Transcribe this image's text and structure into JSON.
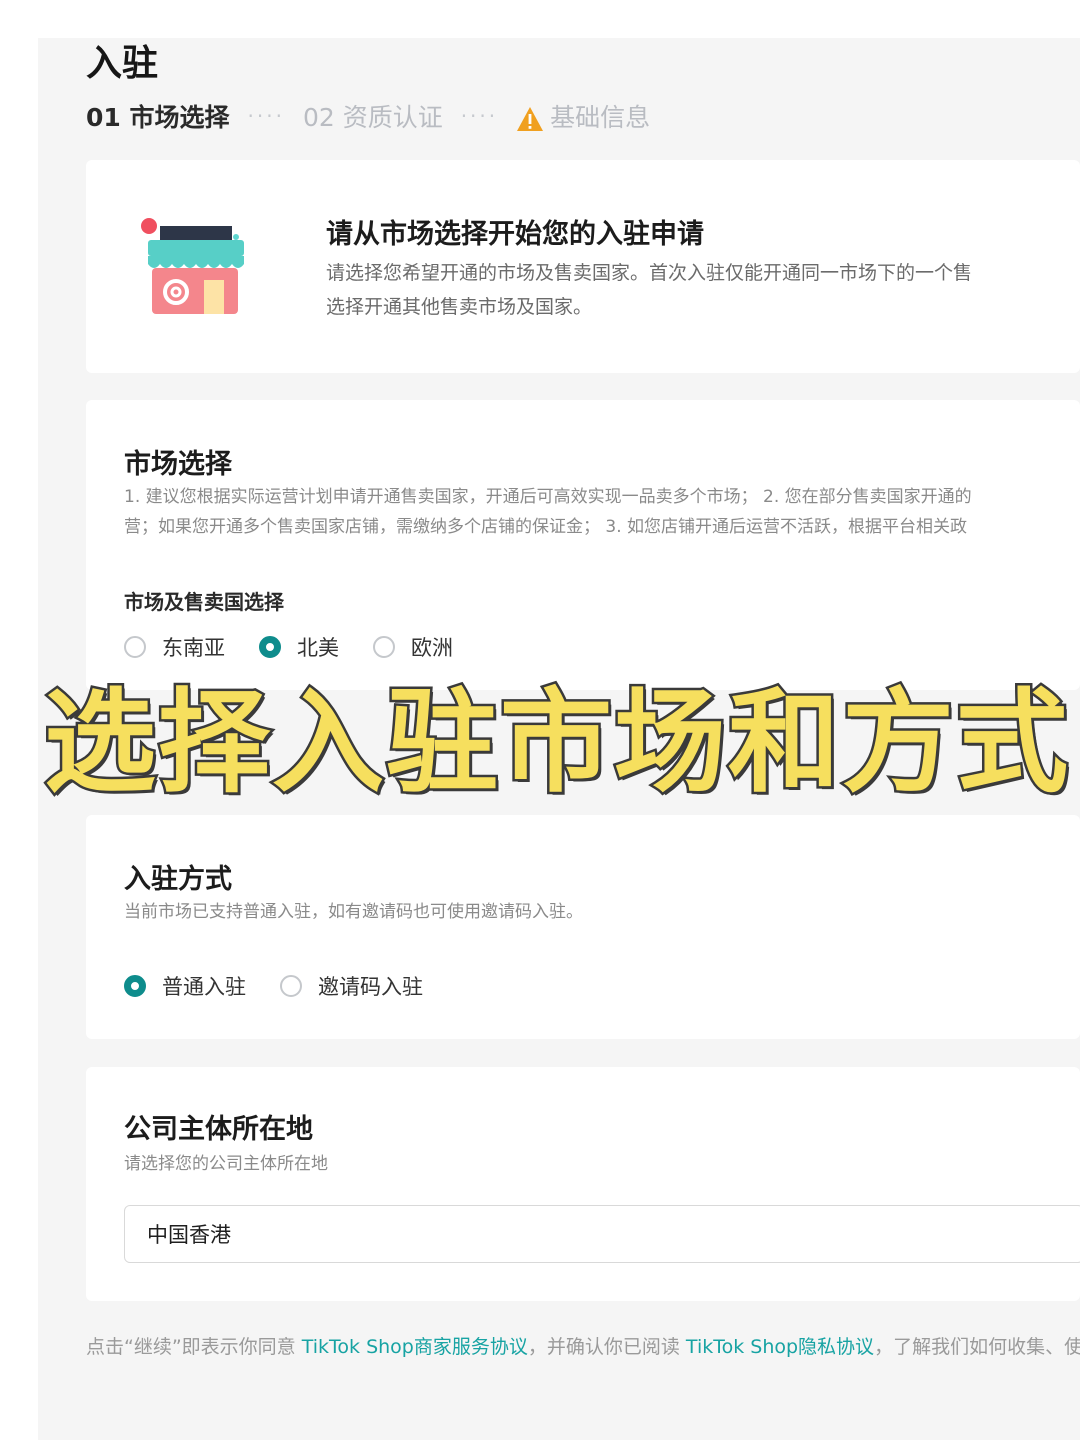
{
  "page": {
    "title": "入驻"
  },
  "steps": [
    {
      "label": "01 市场选择",
      "state": "active"
    },
    {
      "label": "02 资质认证",
      "state": "inactive"
    },
    {
      "label": "基础信息",
      "state": "warning",
      "icon": "warning-icon"
    }
  ],
  "step_separator": "····",
  "intro": {
    "icon": "shop-icon",
    "title": "请从市场选择开始您的入驻申请",
    "desc_line1": "请选择您希望开通的市场及售卖国家。首次入驻仅能开通同一市场下的一个售",
    "desc_line2": "选择开通其他售卖市场及国家。"
  },
  "market": {
    "title": "市场选择",
    "desc_line1": "1. 建议您根据实际运营计划申请开通售卖国家，开通后可高效实现一品卖多个市场； 2. 您在部分售卖国家开通的",
    "desc_line2": "营；如果您开通多个售卖国家店铺，需缴纳多个店铺的保证金； 3. 如您店铺开通后运营不活跃，根据平台相关政",
    "sub_label": "市场及售卖国选择",
    "options": [
      {
        "label": "东南亚",
        "checked": false
      },
      {
        "label": "北美",
        "checked": true
      },
      {
        "label": "欧洲",
        "checked": false
      }
    ]
  },
  "method": {
    "title": "入驻方式",
    "desc": "当前市场已支持普通入驻，如有邀请码也可使用邀请码入驻。",
    "options": [
      {
        "label": "普通入驻",
        "checked": true
      },
      {
        "label": "邀请码入驻",
        "checked": false
      }
    ]
  },
  "location": {
    "title": "公司主体所在地",
    "desc": "请选择您的公司主体所在地",
    "value": "中国香港"
  },
  "footer": {
    "prefix": "点击“继续”即表示你同意 ",
    "link1": "TikTok Shop商家服务协议",
    "middle": "，并确认你已阅读 ",
    "link2": "TikTok Shop隐私协议",
    "suffix": "，了解我们如何收集、使"
  },
  "overlay_caption": "选择入驻市场和方式",
  "colors": {
    "accent": "#0e8c8c",
    "link": "#17a3a3",
    "warning": "#f0a020",
    "caption": "#f6df5e"
  }
}
